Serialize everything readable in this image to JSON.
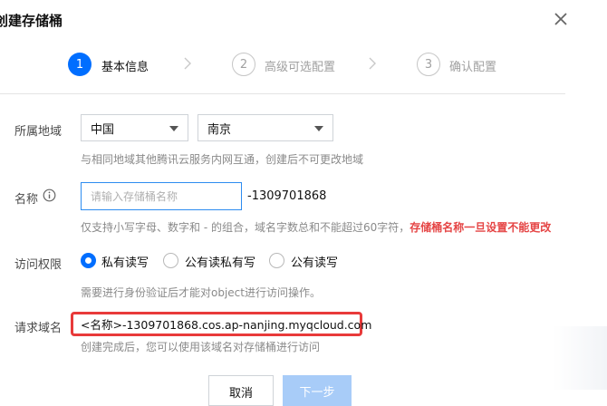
{
  "dialog": {
    "title": "创建存储桶"
  },
  "steps": [
    {
      "number": "1",
      "label": "基本信息"
    },
    {
      "number": "2",
      "label": "高级可选配置"
    },
    {
      "number": "3",
      "label": "确认配置"
    }
  ],
  "form": {
    "region": {
      "label": "所属地域",
      "country_value": "中国",
      "city_value": "南京",
      "hint": "与相同地域其他腾讯云服务内网互通，创建后不可更改地域"
    },
    "name": {
      "label": "名称",
      "placeholder": "请输入存储桶名称",
      "suffix": "-1309701868",
      "hint": "仅支持小写字母、数字和 - 的组合，域名字数总和不能超过60字符，",
      "warning": "存储桶名称一旦设置不能更改"
    },
    "access": {
      "label": "访问权限",
      "options": [
        {
          "label": "私有读写",
          "selected": true
        },
        {
          "label": "公有读私有写",
          "selected": false
        },
        {
          "label": "公有读写",
          "selected": false
        }
      ],
      "hint": "需要进行身份验证后才能对object进行访问操作。"
    },
    "domain": {
      "label": "请求域名",
      "value": "<名称>-1309701868.cos.ap-nanjing.myqcloud.com",
      "hint": "创建完成后，您可以使用该域名对存储桶进行访问"
    }
  },
  "footer": {
    "cancel_label": "取消",
    "next_label": "下一步"
  },
  "colors": {
    "primary": "#006eff",
    "warning": "#e54545",
    "highlight_box": "#e83a3a"
  }
}
